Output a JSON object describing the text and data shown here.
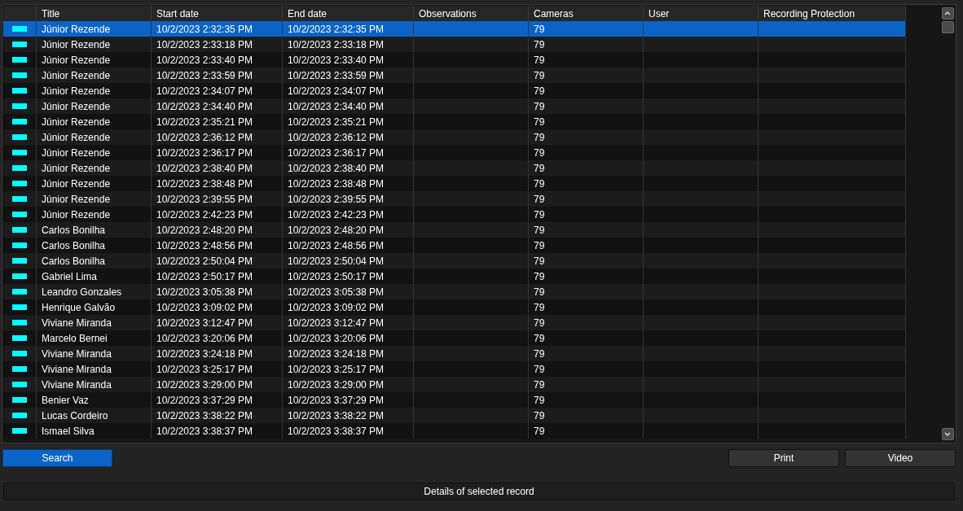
{
  "table": {
    "columns": [
      "Title",
      "Start date",
      "End date",
      "Observations",
      "Cameras",
      "User",
      "Recording Protection"
    ],
    "rows": [
      {
        "color": "#00ffff",
        "selected": true,
        "title": "Júnior Rezende",
        "start": "10/2/2023 2:32:35 PM",
        "end": "10/2/2023 2:32:35 PM",
        "cameras": "79"
      },
      {
        "color": "#00ffff",
        "selected": false,
        "title": "Júnior Rezende",
        "start": "10/2/2023 2:33:18 PM",
        "end": "10/2/2023 2:33:18 PM",
        "cameras": "79"
      },
      {
        "color": "#00ffff",
        "selected": false,
        "title": "Júnior Rezende",
        "start": "10/2/2023 2:33:40 PM",
        "end": "10/2/2023 2:33:40 PM",
        "cameras": "79"
      },
      {
        "color": "#00ffff",
        "selected": false,
        "title": "Júnior Rezende",
        "start": "10/2/2023 2:33:59 PM",
        "end": "10/2/2023 2:33:59 PM",
        "cameras": "79"
      },
      {
        "color": "#00ffff",
        "selected": false,
        "title": "Júnior Rezende",
        "start": "10/2/2023 2:34:07 PM",
        "end": "10/2/2023 2:34:07 PM",
        "cameras": "79"
      },
      {
        "color": "#00ffff",
        "selected": false,
        "title": "Júnior Rezende",
        "start": "10/2/2023 2:34:40 PM",
        "end": "10/2/2023 2:34:40 PM",
        "cameras": "79"
      },
      {
        "color": "#00ffff",
        "selected": false,
        "title": "Júnior Rezende",
        "start": "10/2/2023 2:35:21 PM",
        "end": "10/2/2023 2:35:21 PM",
        "cameras": "79"
      },
      {
        "color": "#00ffff",
        "selected": false,
        "title": "Júnior Rezende",
        "start": "10/2/2023 2:36:12 PM",
        "end": "10/2/2023 2:36:12 PM",
        "cameras": "79"
      },
      {
        "color": "#00ffff",
        "selected": false,
        "title": "Júnior Rezende",
        "start": "10/2/2023 2:36:17 PM",
        "end": "10/2/2023 2:36:17 PM",
        "cameras": "79"
      },
      {
        "color": "#00ffff",
        "selected": false,
        "title": "Júnior Rezende",
        "start": "10/2/2023 2:38:40 PM",
        "end": "10/2/2023 2:38:40 PM",
        "cameras": "79"
      },
      {
        "color": "#00ffff",
        "selected": false,
        "title": "Júnior Rezende",
        "start": "10/2/2023 2:38:48 PM",
        "end": "10/2/2023 2:38:48 PM",
        "cameras": "79"
      },
      {
        "color": "#00ffff",
        "selected": false,
        "title": "Júnior Rezende",
        "start": "10/2/2023 2:39:55 PM",
        "end": "10/2/2023 2:39:55 PM",
        "cameras": "79"
      },
      {
        "color": "#00ffff",
        "selected": false,
        "title": "Júnior Rezende",
        "start": "10/2/2023 2:42:23 PM",
        "end": "10/2/2023 2:42:23 PM",
        "cameras": "79"
      },
      {
        "color": "#00ffff",
        "selected": false,
        "title": "Carlos Bonilha",
        "start": "10/2/2023 2:48:20 PM",
        "end": "10/2/2023 2:48:20 PM",
        "cameras": "79"
      },
      {
        "color": "#00ffff",
        "selected": false,
        "title": "Carlos Bonilha",
        "start": "10/2/2023 2:48:56 PM",
        "end": "10/2/2023 2:48:56 PM",
        "cameras": "79"
      },
      {
        "color": "#00ffff",
        "selected": false,
        "title": "Carlos Bonilha",
        "start": "10/2/2023 2:50:04 PM",
        "end": "10/2/2023 2:50:04 PM",
        "cameras": "79"
      },
      {
        "color": "#00ffff",
        "selected": false,
        "title": "Gabriel Lima",
        "start": "10/2/2023 2:50:17 PM",
        "end": "10/2/2023 2:50:17 PM",
        "cameras": "79"
      },
      {
        "color": "#00ffff",
        "selected": false,
        "title": "Leandro Gonzales",
        "start": "10/2/2023 3:05:38 PM",
        "end": "10/2/2023 3:05:38 PM",
        "cameras": "79"
      },
      {
        "color": "#00ffff",
        "selected": false,
        "title": "Henrique Galvão",
        "start": "10/2/2023 3:09:02 PM",
        "end": "10/2/2023 3:09:02 PM",
        "cameras": "79"
      },
      {
        "color": "#00ffff",
        "selected": false,
        "title": "Viviane Miranda",
        "start": "10/2/2023 3:12:47 PM",
        "end": "10/2/2023 3:12:47 PM",
        "cameras": "79"
      },
      {
        "color": "#00ffff",
        "selected": false,
        "title": "Marcelo Bernei",
        "start": "10/2/2023 3:20:06 PM",
        "end": "10/2/2023 3:20:06 PM",
        "cameras": "79"
      },
      {
        "color": "#00ffff",
        "selected": false,
        "title": "Viviane Miranda",
        "start": "10/2/2023 3:24:18 PM",
        "end": "10/2/2023 3:24:18 PM",
        "cameras": "79"
      },
      {
        "color": "#00ffff",
        "selected": false,
        "title": "Viviane Miranda",
        "start": "10/2/2023 3:25:17 PM",
        "end": "10/2/2023 3:25:17 PM",
        "cameras": "79"
      },
      {
        "color": "#00ffff",
        "selected": false,
        "title": "Viviane Miranda",
        "start": "10/2/2023 3:29:00 PM",
        "end": "10/2/2023 3:29:00 PM",
        "cameras": "79"
      },
      {
        "color": "#00ffff",
        "selected": false,
        "title": "Benier Vaz",
        "start": "10/2/2023 3:37:29 PM",
        "end": "10/2/2023 3:37:29 PM",
        "cameras": "79"
      },
      {
        "color": "#00ffff",
        "selected": false,
        "title": "Lucas Cordeiro",
        "start": "10/2/2023 3:38:22 PM",
        "end": "10/2/2023 3:38:22 PM",
        "cameras": "79"
      },
      {
        "color": "#00ffff",
        "selected": false,
        "title": "Ismael Silva",
        "start": "10/2/2023 3:38:37 PM",
        "end": "10/2/2023 3:38:37 PM",
        "cameras": "79"
      }
    ]
  },
  "buttons": {
    "search": "Search",
    "print": "Print",
    "video": "Video"
  },
  "details_bar": "Details of selected record"
}
